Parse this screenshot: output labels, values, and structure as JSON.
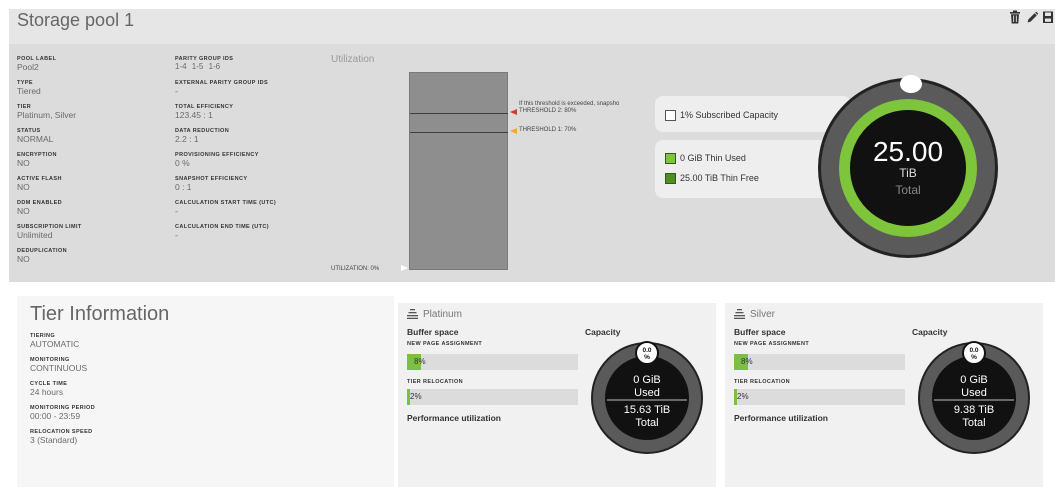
{
  "page": {
    "title": "Storage pool 1"
  },
  "toolbar": {
    "icons": [
      "delete-icon",
      "edit-icon",
      "save-icon"
    ]
  },
  "pool_details": {
    "left": [
      {
        "label": "POOL LABEL",
        "value": "Pool2"
      },
      {
        "label": "TYPE",
        "value": "Tiered"
      },
      {
        "label": "TIER",
        "value": "Platinum, Silver"
      },
      {
        "label": "STATUS",
        "value": "NORMAL"
      },
      {
        "label": "ENCRYPTION",
        "value": "NO"
      },
      {
        "label": "ACTIVE FLASH",
        "value": "NO"
      },
      {
        "label": "DDM ENABLED",
        "value": "NO"
      },
      {
        "label": "SUBSCRIPTION LIMIT",
        "value": "Unlimited"
      },
      {
        "label": "DEDUPLICATION",
        "value": "NO"
      }
    ],
    "right": [
      {
        "label": "PARITY GROUP IDS",
        "value": "1-4  1-5  1-6"
      },
      {
        "label": "EXTERNAL PARITY GROUP IDS",
        "value": "-"
      },
      {
        "label": "TOTAL EFFICIENCY",
        "value": "123.45 : 1"
      },
      {
        "label": "DATA REDUCTION",
        "value": "2.2 : 1"
      },
      {
        "label": "PROVISIONING EFFICIENCY",
        "value": "0 %"
      },
      {
        "label": "SNAPSHOT EFFICIENCY",
        "value": "0 : 1"
      },
      {
        "label": "CALCULATION START TIME (UTC)",
        "value": "-"
      },
      {
        "label": "CALCULATION END TIME (UTC)",
        "value": "-"
      }
    ]
  },
  "utilization": {
    "title": "Utilization",
    "threshold2_note": "If this threshold is exceeded, snapsho",
    "threshold2_label": "THRESHOLD 2: 80%",
    "threshold2_percent": 80,
    "threshold1_label": "THRESHOLD 1: 70%",
    "threshold1_percent": 70,
    "current_label": "UTILIZATION: 0%",
    "current_percent": 0,
    "colors": {
      "bar": "#8e8e8e",
      "threshold2": "#d9392c",
      "threshold1": "#f0a830"
    }
  },
  "capacity_legend": {
    "subscribed": "1% Subscribed Capacity",
    "thin_used": "0 GiB Thin Used",
    "thin_free": "25.00 TiB Thin Free"
  },
  "pool_donut": {
    "value": "25.00",
    "unit": "TiB",
    "label": "Total",
    "colors": {
      "ring": "#7ec53b",
      "outer": "#5a5a5a",
      "center": "#111111"
    }
  },
  "tier_info": {
    "title": "Tier Information",
    "fields": [
      {
        "label": "TIERING",
        "value": "AUTOMATIC"
      },
      {
        "label": "MONITORING",
        "value": "CONTINUOUS"
      },
      {
        "label": "CYCLE TIME",
        "value": "24 hours"
      },
      {
        "label": "MONITORING PERIOD",
        "value": "00:00 - 23:59"
      },
      {
        "label": "RELOCATION SPEED",
        "value": "3 (Standard)"
      }
    ]
  },
  "tiers": [
    {
      "name": "Platinum",
      "buffer_title": "Buffer space",
      "capacity_title": "Capacity",
      "new_page_label": "NEW PAGE ASSIGNMENT",
      "new_page_text": "8%",
      "new_page_percent": 8,
      "relocation_label": "TIER RELOCATION",
      "relocation_text": "2%",
      "relocation_percent": 2,
      "perf_title": "Performance utilization",
      "donut_badge": "0.0\n%",
      "used_value": "0 GiB",
      "used_label": "Used",
      "total_value": "15.63 TiB",
      "total_label": "Total"
    },
    {
      "name": "Silver",
      "buffer_title": "Buffer space",
      "capacity_title": "Capacity",
      "new_page_label": "NEW PAGE ASSIGNMENT",
      "new_page_text": "8%",
      "new_page_percent": 8,
      "relocation_label": "TIER RELOCATION",
      "relocation_text": "2%",
      "relocation_percent": 2,
      "perf_title": "Performance utilization",
      "donut_badge": "0.0\n%",
      "used_value": "0 GiB",
      "used_label": "Used",
      "total_value": "9.38 TiB",
      "total_label": "Total"
    }
  ]
}
